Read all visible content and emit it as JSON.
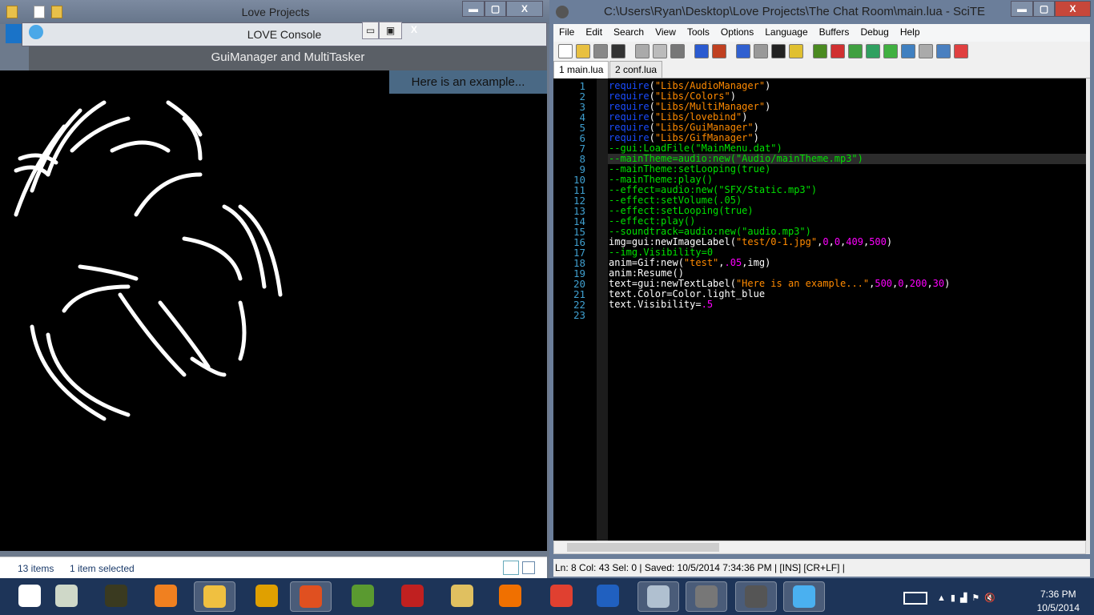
{
  "explorer": {
    "title": "Love Projects",
    "status_items": "13 items",
    "status_selected": "1 item selected",
    "controls": {
      "minimize": "▬",
      "maximize": "▢",
      "close": "X"
    }
  },
  "love": {
    "title": "LOVE Console",
    "header": "GuiManager and MultiTasker",
    "label": "Here is an example...",
    "controls": {
      "minimize": "▭",
      "maximize": "▣",
      "close": "X"
    }
  },
  "scite": {
    "title": "C:\\Users\\Ryan\\Desktop\\Love Projects\\The Chat Room\\main.lua - SciTE",
    "controls": {
      "minimize": "▬",
      "maximize": "▢",
      "close": "X"
    },
    "menu": [
      "File",
      "Edit",
      "Search",
      "View",
      "Tools",
      "Options",
      "Language",
      "Buffers",
      "Debug",
      "Help"
    ],
    "toolbar_icons": [
      "new-icon",
      "open-icon",
      "save-icon",
      "print-icon",
      "cut-icon",
      "copy-icon",
      "paste-icon",
      "find-icon",
      "replace-icon",
      "run-icon",
      "stop-icon",
      "console-icon",
      "build-icon",
      "bug-icon",
      "flag-icon",
      "arrow-right-icon",
      "shuffle-icon",
      "redo-icon",
      "eye-icon",
      "calculator-icon",
      "export-icon",
      "stop-sign-icon"
    ],
    "tabs": [
      {
        "label": "1 main.lua",
        "active": true
      },
      {
        "label": "2 conf.lua",
        "active": false
      }
    ],
    "current_line": 8,
    "code": [
      [
        [
          "kw",
          "require"
        ],
        [
          "df",
          "("
        ],
        [
          "str",
          "\"Libs/AudioManager\""
        ],
        [
          "df",
          ")"
        ]
      ],
      [
        [
          "kw",
          "require"
        ],
        [
          "df",
          "("
        ],
        [
          "str",
          "\"Libs/Colors\""
        ],
        [
          "df",
          ")"
        ]
      ],
      [
        [
          "kw",
          "require"
        ],
        [
          "df",
          "("
        ],
        [
          "str",
          "\"Libs/MultiManager\""
        ],
        [
          "df",
          ")"
        ]
      ],
      [
        [
          "kw",
          "require"
        ],
        [
          "df",
          "("
        ],
        [
          "str",
          "\"Libs/lovebind\""
        ],
        [
          "df",
          ")"
        ]
      ],
      [
        [
          "kw",
          "require"
        ],
        [
          "df",
          "("
        ],
        [
          "str",
          "\"Libs/GuiManager\""
        ],
        [
          "df",
          ")"
        ]
      ],
      [
        [
          "kw",
          "require"
        ],
        [
          "df",
          "("
        ],
        [
          "str",
          "\"Libs/GifManager\""
        ],
        [
          "df",
          ")"
        ]
      ],
      [
        [
          "cm",
          "--gui:LoadFile(\"MainMenu.dat\")"
        ]
      ],
      [
        [
          "cm",
          "--mainTheme=audio:new(\"Audio/mainTheme.mp3\")"
        ]
      ],
      [
        [
          "cm",
          "--mainTheme:setLooping(true)"
        ]
      ],
      [
        [
          "cm",
          "--mainTheme:play()"
        ]
      ],
      [
        [
          "cm",
          "--effect=audio:new(\"SFX/Static.mp3\")"
        ]
      ],
      [
        [
          "cm",
          "--effect:setVolume(.05)"
        ]
      ],
      [
        [
          "cm",
          "--effect:setLooping(true)"
        ]
      ],
      [
        [
          "cm",
          "--effect:play()"
        ]
      ],
      [
        [
          "cm",
          "--soundtrack=audio:new(\"audio.mp3\")"
        ]
      ],
      [
        [
          "df",
          "img=gui:newImageLabel("
        ],
        [
          "str",
          "\"test/0-1.jpg\""
        ],
        [
          "df",
          ","
        ],
        [
          "num",
          "0"
        ],
        [
          "df",
          ","
        ],
        [
          "num",
          "0"
        ],
        [
          "df",
          ","
        ],
        [
          "num",
          "409"
        ],
        [
          "df",
          ","
        ],
        [
          "num",
          "500"
        ],
        [
          "df",
          ")"
        ]
      ],
      [
        [
          "cm",
          "--img.Visibility=0"
        ]
      ],
      [
        [
          "df",
          "anim=Gif:new("
        ],
        [
          "str",
          "\"test\""
        ],
        [
          "df",
          ","
        ],
        [
          "num",
          ".05"
        ],
        [
          "df",
          ",img)"
        ]
      ],
      [
        [
          "df",
          "anim:Resume()"
        ]
      ],
      [
        [
          "df",
          "text=gui:newTextLabel("
        ],
        [
          "str",
          "\"Here is an example...\""
        ],
        [
          "df",
          ","
        ],
        [
          "num",
          "500"
        ],
        [
          "df",
          ","
        ],
        [
          "num",
          "0"
        ],
        [
          "df",
          ","
        ],
        [
          "num",
          "200"
        ],
        [
          "df",
          ","
        ],
        [
          "num",
          "30"
        ],
        [
          "df",
          ")"
        ]
      ],
      [
        [
          "df",
          "text.Color=Color.light_blue"
        ]
      ],
      [
        [
          "df",
          "text.Visibility="
        ],
        [
          "num",
          ".5"
        ]
      ],
      []
    ],
    "status": "Ln: 8 Col: 43 Sel: 0  |  Saved: 10/5/2014  7:34:36 PM  |  [INS]  [CR+LF] |"
  },
  "taskbar": {
    "apps": [
      "task-view",
      "notepad-app",
      "game-app",
      "crossed-app",
      "file-explorer",
      "aimp",
      "firefox-like",
      "minecraft",
      "red-app",
      "shovel-app",
      "vlc",
      "chrome",
      "blue-app",
      "monitor-app",
      "scite",
      "gimp",
      "love"
    ],
    "active": [
      "file-explorer",
      "firefox-like",
      "monitor-app",
      "scite",
      "gimp",
      "love"
    ],
    "time": "7:36 PM",
    "date": "10/5/2014"
  },
  "colors": {
    "keyword": "#1a4cff",
    "string": "#ff8a00",
    "comment": "#00e000",
    "number": "#ff00ff",
    "label_bg": "#4a6985",
    "taskbar": "#1d3458"
  }
}
